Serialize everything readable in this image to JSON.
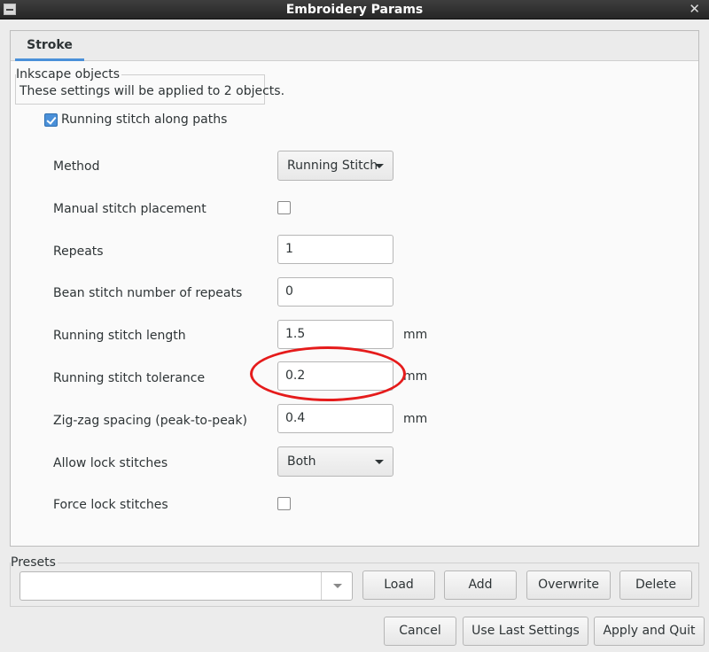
{
  "window": {
    "title": "Embroidery Params"
  },
  "tabs": [
    {
      "label": "Stroke"
    }
  ],
  "inkscape_objects": {
    "label": "Inkscape objects",
    "text": "These settings will be applied to 2 objects."
  },
  "running_stitch": {
    "label": "Running stitch along paths",
    "checked": true
  },
  "fields": {
    "method": {
      "label": "Method",
      "value": "Running Stitch"
    },
    "manual_stitch_placement": {
      "label": "Manual stitch placement",
      "checked": false
    },
    "repeats": {
      "label": "Repeats",
      "value": "1"
    },
    "bean_stitch_repeats": {
      "label": "Bean stitch number of repeats",
      "value": "0"
    },
    "running_stitch_length": {
      "label": "Running stitch length",
      "value": "1.5",
      "unit": "mm"
    },
    "running_stitch_tolerance": {
      "label": "Running stitch tolerance",
      "value": "0.2",
      "unit": "mm"
    },
    "zigzag_spacing": {
      "label": "Zig-zag spacing (peak-to-peak)",
      "value": "0.4",
      "unit": "mm"
    },
    "allow_lock_stitches": {
      "label": "Allow lock stitches",
      "value": "Both"
    },
    "force_lock_stitches": {
      "label": "Force lock stitches",
      "checked": false
    }
  },
  "presets": {
    "label": "Presets",
    "value": "",
    "load_label": "Load",
    "add_label": "Add",
    "overwrite_label": "Overwrite",
    "delete_label": "Delete"
  },
  "footer": {
    "cancel_label": "Cancel",
    "use_last_label": "Use Last Settings",
    "apply_label": "Apply and Quit"
  },
  "colors": {
    "accent": "#4a90d9",
    "highlight": "#e51b1b",
    "titlebar": "#2d2d2d"
  },
  "icons": {
    "window_menu": "window-menu-icon",
    "close": "close-icon",
    "dropdown": "chevron-down-icon",
    "check": "checkmark-icon"
  }
}
